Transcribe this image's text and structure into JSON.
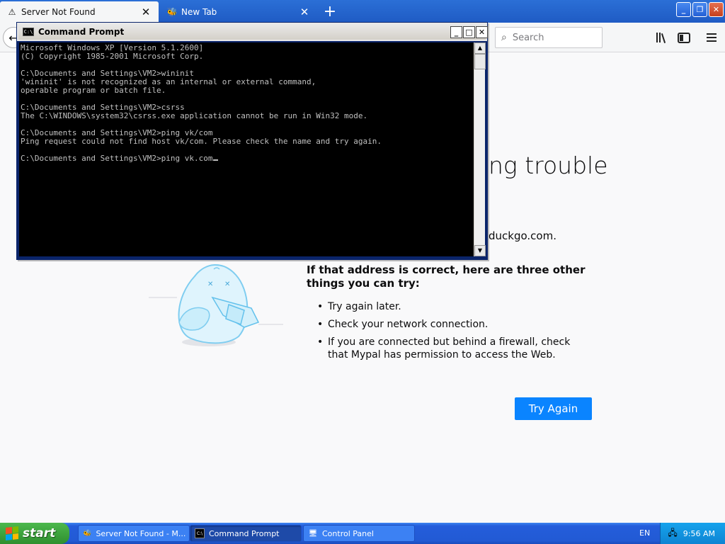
{
  "browser": {
    "tabs": [
      {
        "label": "Server Not Found",
        "icon": "warning-icon",
        "active": true
      },
      {
        "label": "New Tab",
        "icon": "bee-icon",
        "active": false
      }
    ],
    "search_placeholder": "Search"
  },
  "error_page": {
    "title_partial": "ng trouble",
    "url_partial": "duckgo.com.",
    "heading": "If that address is correct, here are three other things you can try:",
    "suggestions": [
      "Try again later.",
      "Check your network connection.",
      "If you are connected but behind a firewall, check that Mypal has permission to access the Web."
    ],
    "try_again_label": "Try Again"
  },
  "cmd": {
    "title": "Command Prompt",
    "lines": [
      "Microsoft Windows XP [Version 5.1.2600]",
      "(C) Copyright 1985-2001 Microsoft Corp.",
      "",
      "C:\\Documents and Settings\\VM2>wininit",
      "'wininit' is not recognized as an internal or external command,",
      "operable program or batch file.",
      "",
      "C:\\Documents and Settings\\VM2>csrss",
      "The C:\\WINDOWS\\system32\\csrss.exe application cannot be run in Win32 mode.",
      "",
      "C:\\Documents and Settings\\VM2>ping vk/com",
      "Ping request could not find host vk/com. Please check the name and try again.",
      "",
      "C:\\Documents and Settings\\VM2>ping vk.com"
    ]
  },
  "taskbar": {
    "start_label": "start",
    "tasks": [
      {
        "label": "Server Not Found - M...",
        "icon": "bee-icon",
        "active": false
      },
      {
        "label": "Command Prompt",
        "icon": "cmd-icon",
        "active": true
      },
      {
        "label": "Control Panel",
        "icon": "control-panel-icon",
        "active": false
      }
    ],
    "language": "EN",
    "clock": "9:56 AM"
  },
  "colors": {
    "accent": "#0a84ff",
    "xp_blue": "#245ddb",
    "start_green": "#3c9e3c"
  }
}
